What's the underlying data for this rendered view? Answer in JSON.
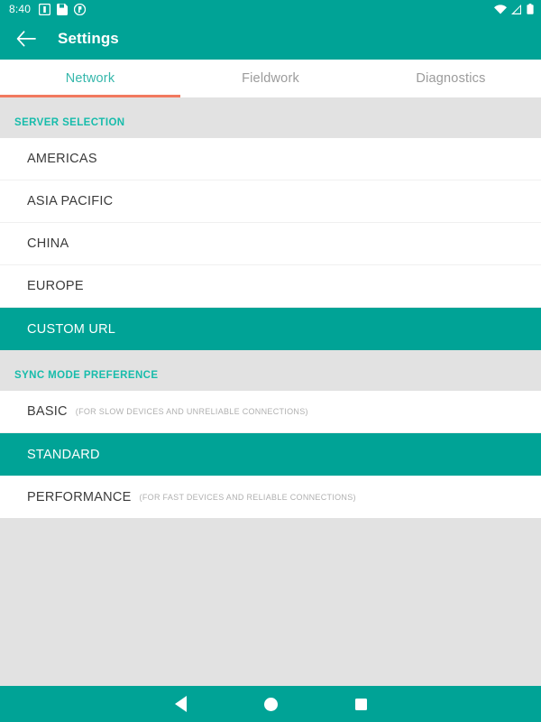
{
  "status_bar": {
    "clock": "8:40",
    "left_icons": [
      "notification-icon",
      "save-icon",
      "app-badge-icon"
    ],
    "right_icons": [
      "wifi-icon",
      "cell-signal-icon",
      "battery-icon"
    ]
  },
  "app_bar": {
    "back_icon": "arrow-back-icon",
    "title": "Settings"
  },
  "tabs": {
    "items": [
      {
        "label": "Network",
        "active": true
      },
      {
        "label": "Fieldwork",
        "active": false
      },
      {
        "label": "Diagnostics",
        "active": false
      }
    ],
    "indicator_color": "#f1795f",
    "active_color": "#35b7ab",
    "inactive_color": "#9b9b9b"
  },
  "sections": [
    {
      "header": "SERVER SELECTION",
      "rows": [
        {
          "label": "AMERICAS",
          "hint": "",
          "selected": false
        },
        {
          "label": "ASIA PACIFIC",
          "hint": "",
          "selected": false
        },
        {
          "label": "CHINA",
          "hint": "",
          "selected": false
        },
        {
          "label": "EUROPE",
          "hint": "",
          "selected": false
        },
        {
          "label": "CUSTOM URL",
          "hint": "",
          "selected": true
        }
      ]
    },
    {
      "header": "SYNC MODE PREFERENCE",
      "rows": [
        {
          "label": "BASIC",
          "hint": "(FOR SLOW DEVICES AND UNRELIABLE CONNECTIONS)",
          "selected": false
        },
        {
          "label": "STANDARD",
          "hint": "",
          "selected": true
        },
        {
          "label": "PERFORMANCE",
          "hint": "(FOR FAST DEVICES AND RELIABLE CONNECTIONS)",
          "selected": false
        }
      ]
    }
  ],
  "nav_bar": {
    "back": "nav-back-icon",
    "home": "nav-home-icon",
    "recents": "nav-recents-icon"
  },
  "colors": {
    "primary_teal": "#00a396",
    "accent_orange": "#f1795f",
    "section_header_teal": "#17bcab",
    "background_gray": "#e2e2e2",
    "surface_white": "#ffffff"
  }
}
